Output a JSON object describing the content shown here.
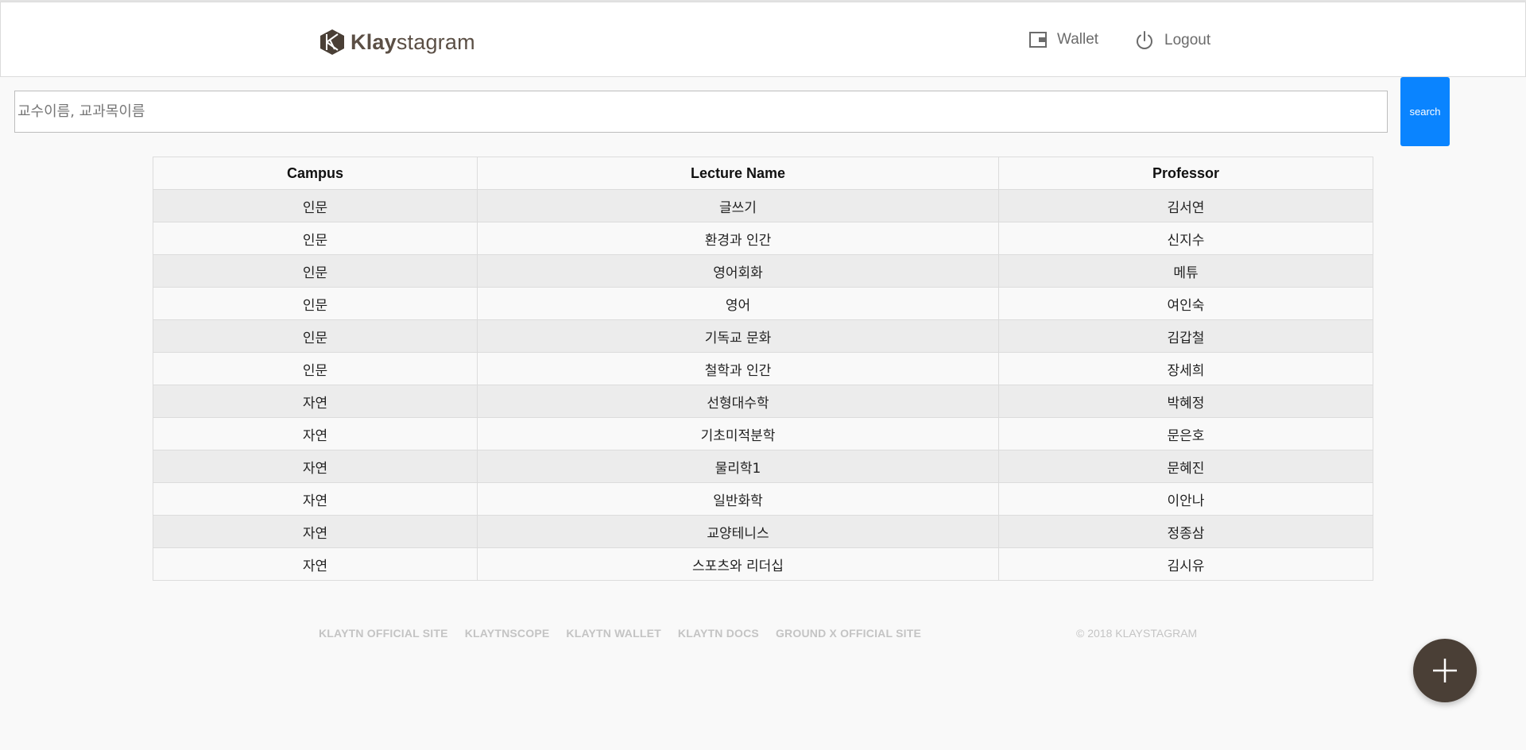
{
  "header": {
    "logo_main": "Klay",
    "logo_rest": "stagram",
    "wallet_label": "Wallet",
    "logout_label": "Logout"
  },
  "search": {
    "placeholder": "교수이름, 교과목이름",
    "button_label": "search"
  },
  "table": {
    "headers": [
      "Campus",
      "Lecture Name",
      "Professor"
    ],
    "rows": [
      [
        "인문",
        "글쓰기",
        "김서연"
      ],
      [
        "인문",
        "환경과 인간",
        "신지수"
      ],
      [
        "인문",
        "영어회화",
        "메튜"
      ],
      [
        "인문",
        "영어",
        "여인숙"
      ],
      [
        "인문",
        "기독교 문화",
        "김갑철"
      ],
      [
        "인문",
        "철학과 인간",
        "장세희"
      ],
      [
        "자연",
        "선형대수학",
        "박혜정"
      ],
      [
        "자연",
        "기초미적분학",
        "문은호"
      ],
      [
        "자연",
        "물리학1",
        "문혜진"
      ],
      [
        "자연",
        "일반화학",
        "이안나"
      ],
      [
        "자연",
        "교양테니스",
        "정종삼"
      ],
      [
        "자연",
        "스포츠와 리더십",
        "김시유"
      ]
    ]
  },
  "footer": {
    "links": [
      "KLAYTN OFFICIAL SITE",
      "KLAYTNSCOPE",
      "KLAYTN WALLET",
      "KLAYTN DOCS",
      "GROUND X OFFICIAL SITE"
    ],
    "copyright": "© 2018 KLAYSTAGRAM"
  },
  "colors": {
    "accent": "#0a84ff",
    "brand": "#4a3f36"
  },
  "icons": {
    "logo": "klaytn-logo-icon",
    "wallet": "wallet-icon",
    "logout": "power-icon",
    "fab": "plus-icon"
  }
}
